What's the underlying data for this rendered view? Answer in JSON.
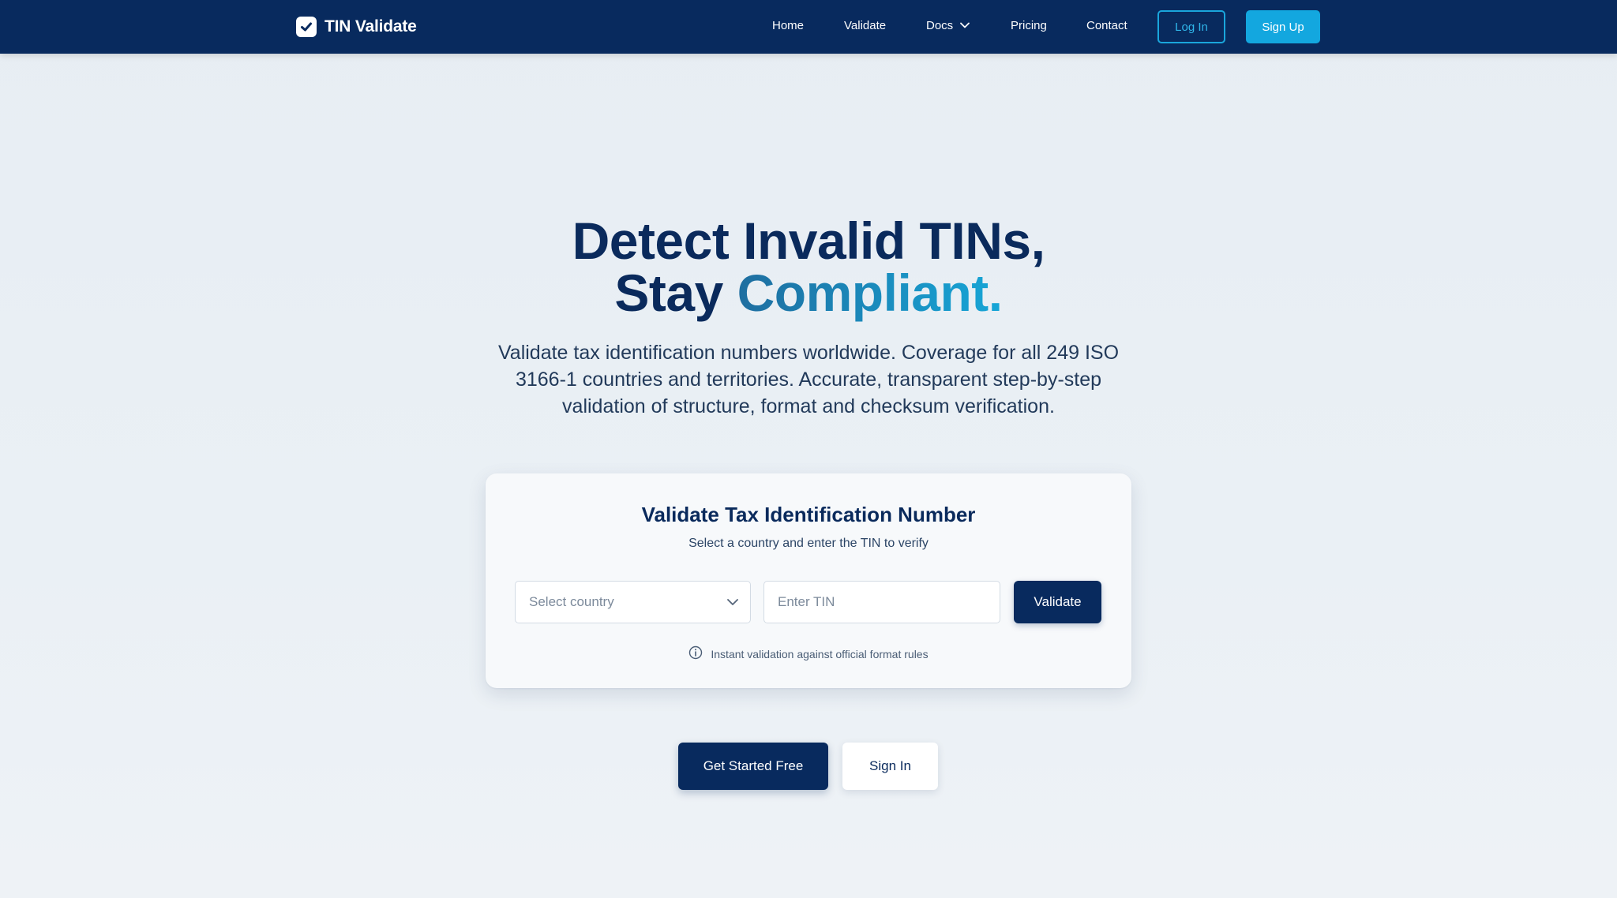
{
  "nav": {
    "brand_name": "TIN Validate",
    "links": {
      "home": "Home",
      "validate": "Validate",
      "docs": "Docs",
      "pricing": "Pricing",
      "contact": "Contact"
    },
    "login_label": "Log In",
    "signup_label": "Sign Up"
  },
  "hero": {
    "title_line1": "Detect Invalid TINs,",
    "title_line2_plain": "Stay ",
    "title_line2_accent": "Compliant.",
    "subtitle": "Validate tax identification numbers worldwide. Coverage for all 249 ISO 3166-1 countries and territories. Accurate, transparent step-by-step validation of structure, format and checksum verification."
  },
  "card": {
    "title": "Validate Tax Identification Number",
    "subtitle": "Select a country and enter the TIN to verify",
    "country_placeholder": "Select country",
    "tin_placeholder": "Enter TIN",
    "validate_label": "Validate",
    "note": "Instant validation against official format rules"
  },
  "cta": {
    "primary_label": "Get Started Free",
    "secondary_label": "Sign In"
  },
  "colors": {
    "navy": "#082a5e",
    "accent": "#13a7df",
    "background": "#e9eff4"
  }
}
